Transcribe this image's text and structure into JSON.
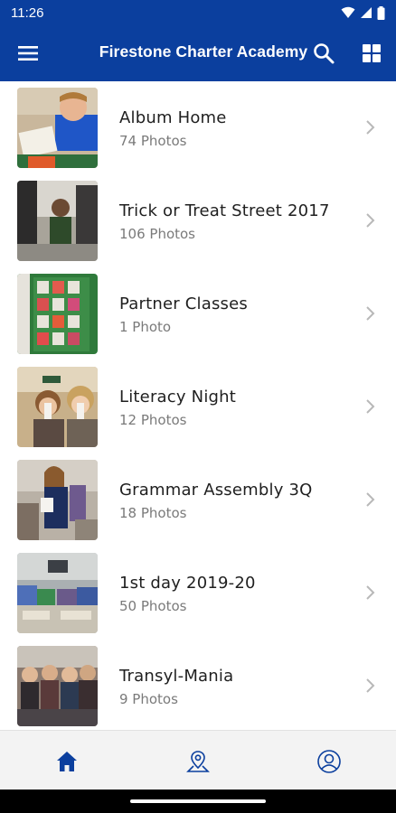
{
  "status_bar": {
    "time": "11:26"
  },
  "app_bar": {
    "title": "Firestone Charter Academy",
    "menu_icon": "hamburger-menu-icon",
    "search_icon": "search-icon",
    "grid_icon": "grid-view-icon"
  },
  "colors": {
    "primary": "#0b3f9e",
    "text": "#1f1f1f",
    "subtext": "#7a7a7a",
    "chevron": "#b8b8b8",
    "nav_bg": "#f3f3f3"
  },
  "albums": [
    {
      "title": "Album Home",
      "count": "74 Photos"
    },
    {
      "title": "Trick or Treat Street 2017",
      "count": "106 Photos"
    },
    {
      "title": "Partner Classes",
      "count": "1 Photo"
    },
    {
      "title": "Literacy Night",
      "count": "12 Photos"
    },
    {
      "title": "Grammar Assembly 3Q",
      "count": "18 Photos"
    },
    {
      "title": "1st day 2019-20",
      "count": "50 Photos"
    },
    {
      "title": "Transyl-Mania",
      "count": "9 Photos"
    }
  ],
  "bottom_nav": [
    {
      "icon": "home-icon",
      "active": true
    },
    {
      "icon": "location-pin-icon",
      "active": false
    },
    {
      "icon": "profile-icon",
      "active": false
    }
  ]
}
